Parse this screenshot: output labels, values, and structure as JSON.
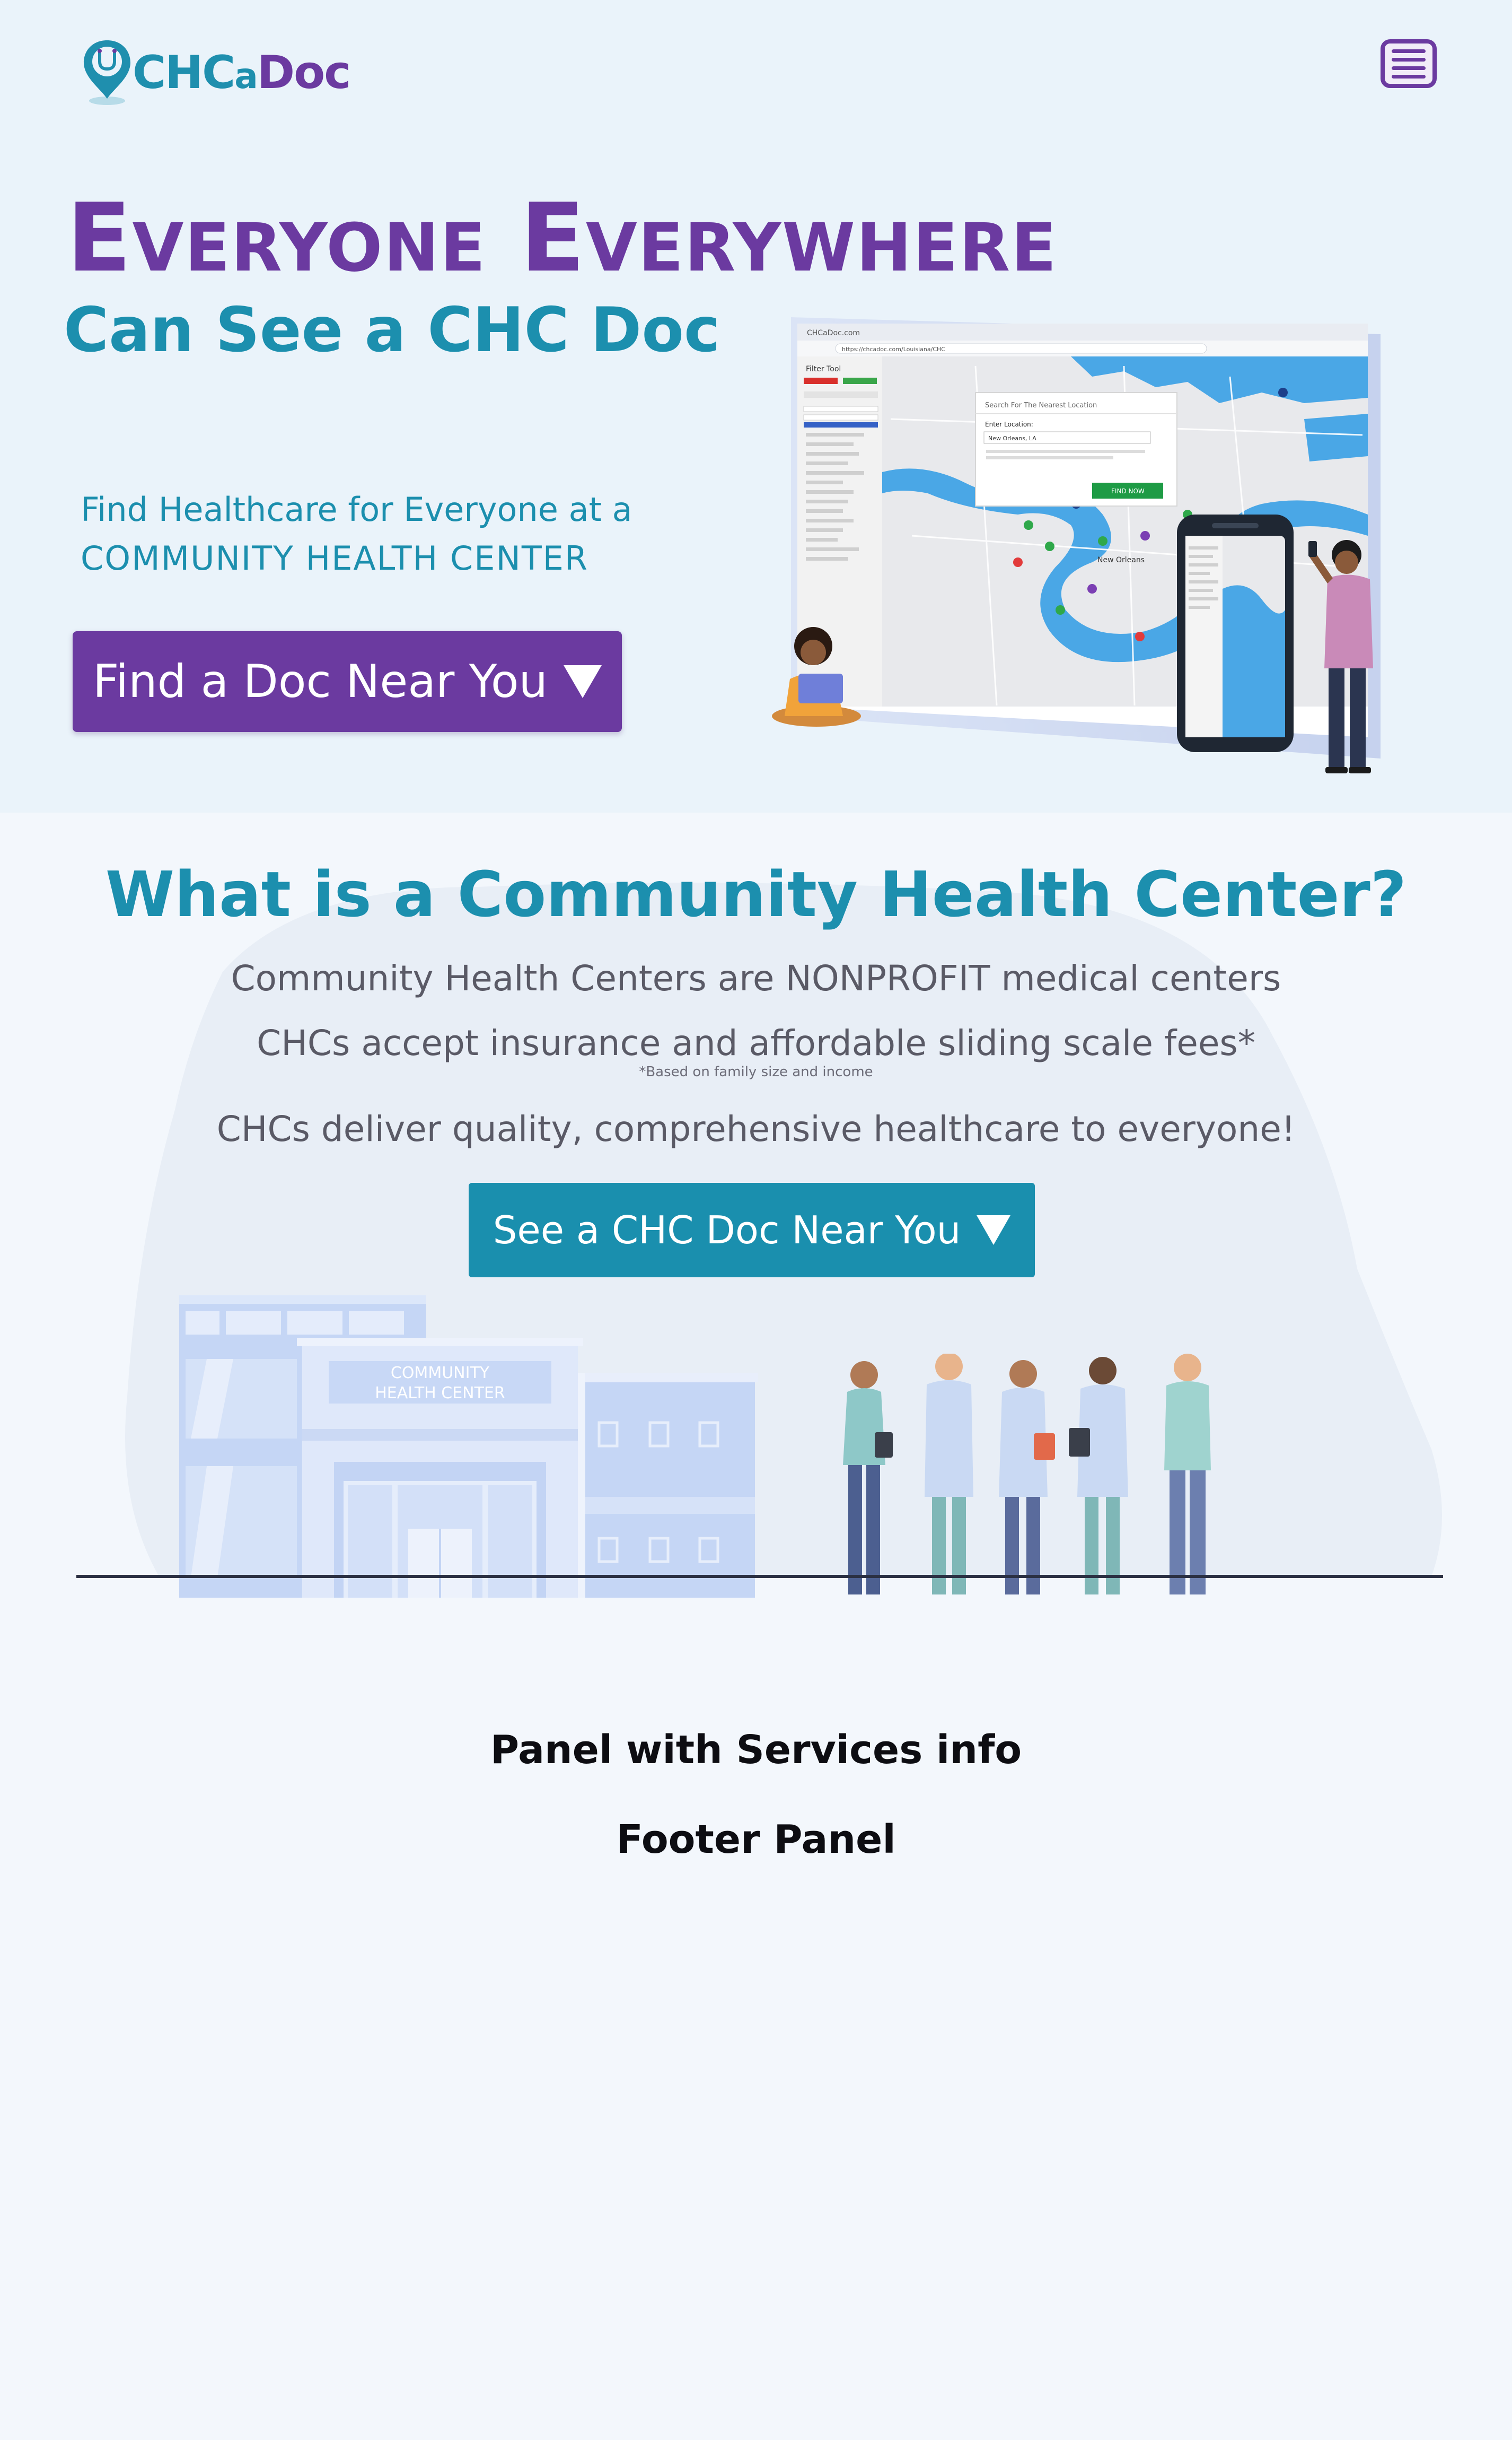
{
  "header": {
    "logo_parts": [
      "CHC",
      "a",
      "Doc"
    ],
    "menu_icon": "hamburger-menu-icon"
  },
  "hero": {
    "title": "Everyone Everywhere",
    "subtitle": "Can See a CHC Doc",
    "tagline_line1": "Find Healthcare for Everyone at a",
    "tagline_line2": "COMMUNITY HEALTH CENTER",
    "cta_label": "Find a Doc Near You"
  },
  "hero_image": {
    "browser_tab": "CHCaDoc.com",
    "address_bar": "https://chcadoc.com/Louisiana/CHC",
    "sidebar_title": "Filter Tool",
    "modal_title": "Search For The Nearest Location",
    "modal_label": "Enter Location:",
    "modal_value": "New Orleans, LA",
    "modal_button": "FIND NOW",
    "city_label": "New Orleans"
  },
  "chc": {
    "heading": "What is a Community Health Center?",
    "line1": "Community Health Centers are NONPROFIT medical centers",
    "line2": "CHCs accept insurance and affordable sliding scale fees*",
    "note": "*Based on family size and income",
    "line3": "CHCs deliver quality, comprehensive healthcare to everyone!",
    "cta_label": "See a CHC Doc Near You",
    "building_sign_line1": "COMMUNITY",
    "building_sign_line2": "HEALTH CENTER"
  },
  "panels": {
    "services": "Panel with Services info",
    "footer": "Footer Panel"
  },
  "colors": {
    "brand_purple": "#6b3aa0",
    "brand_teal": "#1c8fae",
    "hero_bg": "#eaf3fa",
    "page_bg": "#f3f7fc"
  }
}
